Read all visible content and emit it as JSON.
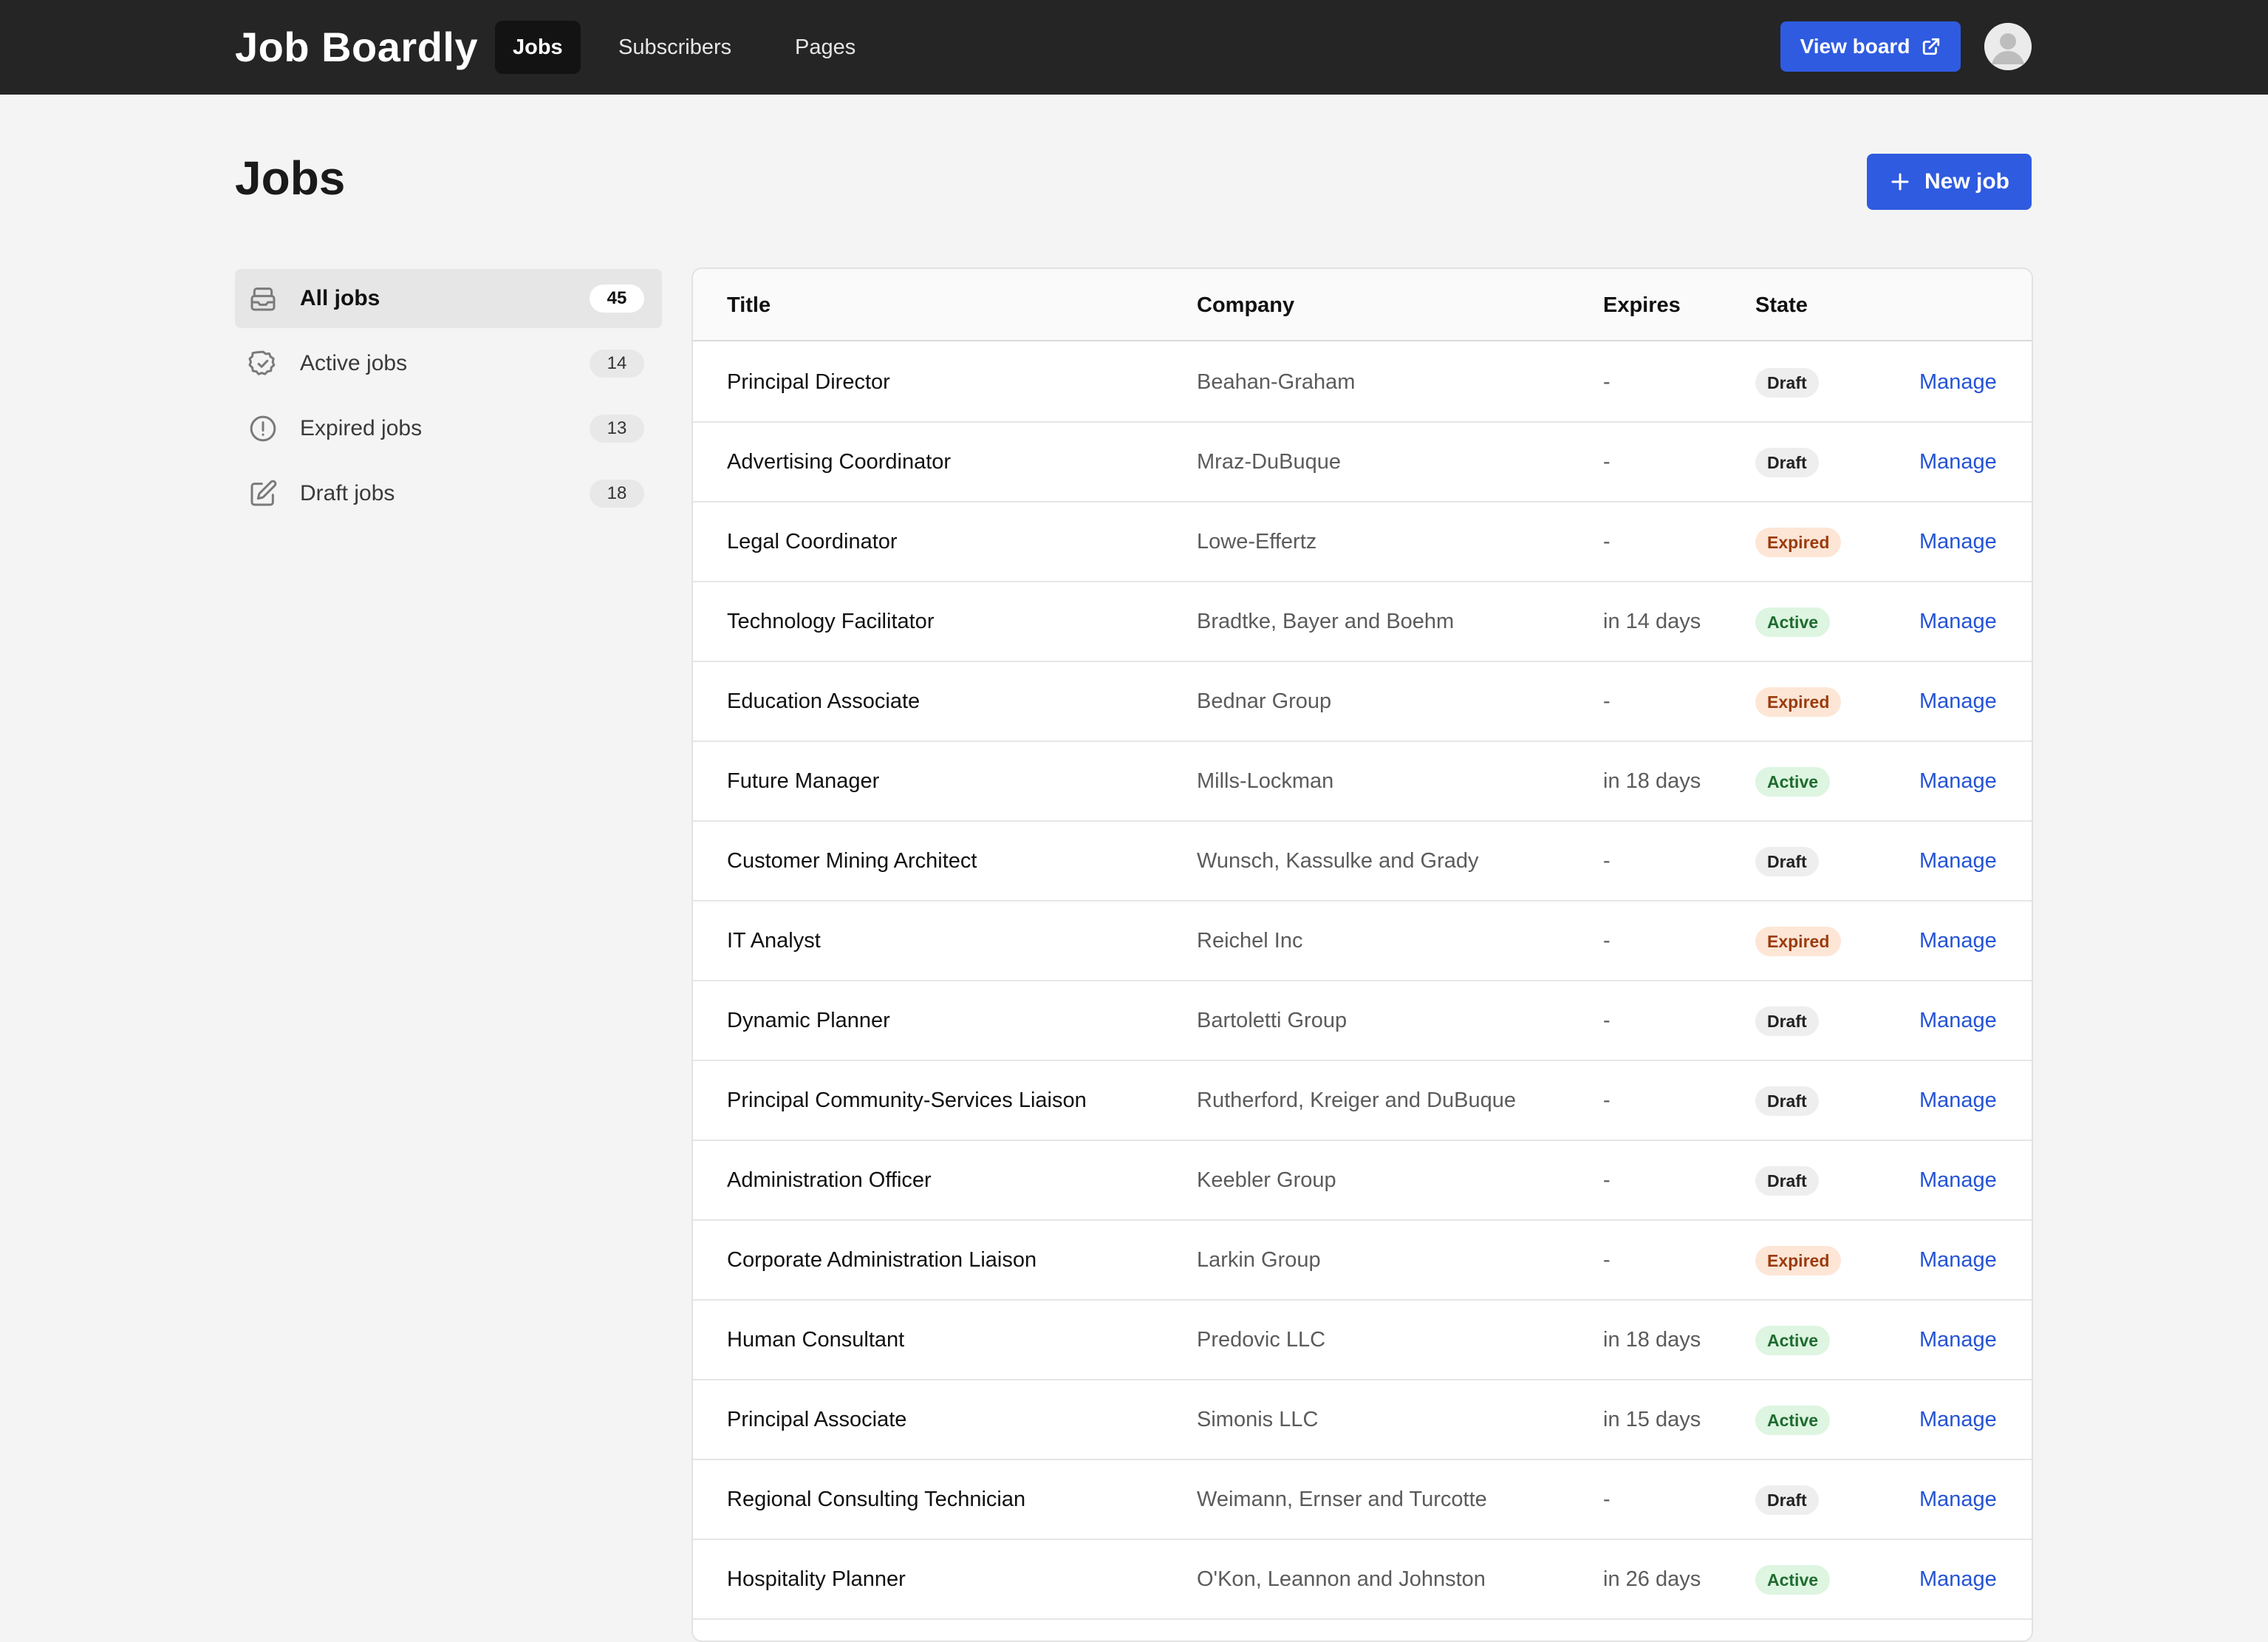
{
  "app": {
    "brand": "Job Boardly",
    "nav": [
      {
        "label": "Jobs",
        "active": true
      },
      {
        "label": "Subscribers",
        "active": false
      },
      {
        "label": "Pages",
        "active": false
      }
    ],
    "view_board_label": "View board",
    "accent_color": "#2f5be0"
  },
  "page": {
    "title": "Jobs",
    "new_job_label": "New job"
  },
  "sidebar": {
    "items": [
      {
        "label": "All jobs",
        "count": "45",
        "icon": "inbox-icon",
        "active": true
      },
      {
        "label": "Active jobs",
        "count": "14",
        "icon": "check-circle-icon",
        "active": false
      },
      {
        "label": "Expired jobs",
        "count": "13",
        "icon": "alert-circle-icon",
        "active": false
      },
      {
        "label": "Draft jobs",
        "count": "18",
        "icon": "edit-icon",
        "active": false
      }
    ]
  },
  "table": {
    "headers": {
      "title": "Title",
      "company": "Company",
      "expires": "Expires",
      "state": "State"
    },
    "rows": [
      {
        "title": "Principal Director",
        "company": "Beahan-Graham",
        "expires": "-",
        "state": "Draft",
        "action": "Manage"
      },
      {
        "title": "Advertising Coordinator",
        "company": "Mraz-DuBuque",
        "expires": "-",
        "state": "Draft",
        "action": "Manage"
      },
      {
        "title": "Legal Coordinator",
        "company": "Lowe-Effertz",
        "expires": "-",
        "state": "Expired",
        "action": "Manage"
      },
      {
        "title": "Technology Facilitator",
        "company": "Bradtke, Bayer and Boehm",
        "expires": "in 14 days",
        "state": "Active",
        "action": "Manage"
      },
      {
        "title": "Education Associate",
        "company": "Bednar Group",
        "expires": "-",
        "state": "Expired",
        "action": "Manage"
      },
      {
        "title": "Future Manager",
        "company": "Mills-Lockman",
        "expires": "in 18 days",
        "state": "Active",
        "action": "Manage"
      },
      {
        "title": "Customer Mining Architect",
        "company": "Wunsch, Kassulke and Grady",
        "expires": "-",
        "state": "Draft",
        "action": "Manage"
      },
      {
        "title": "IT Analyst",
        "company": "Reichel Inc",
        "expires": "-",
        "state": "Expired",
        "action": "Manage"
      },
      {
        "title": "Dynamic Planner",
        "company": "Bartoletti Group",
        "expires": "-",
        "state": "Draft",
        "action": "Manage"
      },
      {
        "title": "Principal Community-Services Liaison",
        "company": "Rutherford, Kreiger and DuBuque",
        "expires": "-",
        "state": "Draft",
        "action": "Manage"
      },
      {
        "title": "Administration Officer",
        "company": "Keebler Group",
        "expires": "-",
        "state": "Draft",
        "action": "Manage"
      },
      {
        "title": "Corporate Administration Liaison",
        "company": "Larkin Group",
        "expires": "-",
        "state": "Expired",
        "action": "Manage"
      },
      {
        "title": "Human Consultant",
        "company": "Predovic LLC",
        "expires": "in 18 days",
        "state": "Active",
        "action": "Manage"
      },
      {
        "title": "Principal Associate",
        "company": "Simonis LLC",
        "expires": "in 15 days",
        "state": "Active",
        "action": "Manage"
      },
      {
        "title": "Regional Consulting Technician",
        "company": "Weimann, Ernser and Turcotte",
        "expires": "-",
        "state": "Draft",
        "action": "Manage"
      },
      {
        "title": "Hospitality Planner",
        "company": "O'Kon, Leannon and Johnston",
        "expires": "in 26 days",
        "state": "Active",
        "action": "Manage"
      }
    ]
  }
}
